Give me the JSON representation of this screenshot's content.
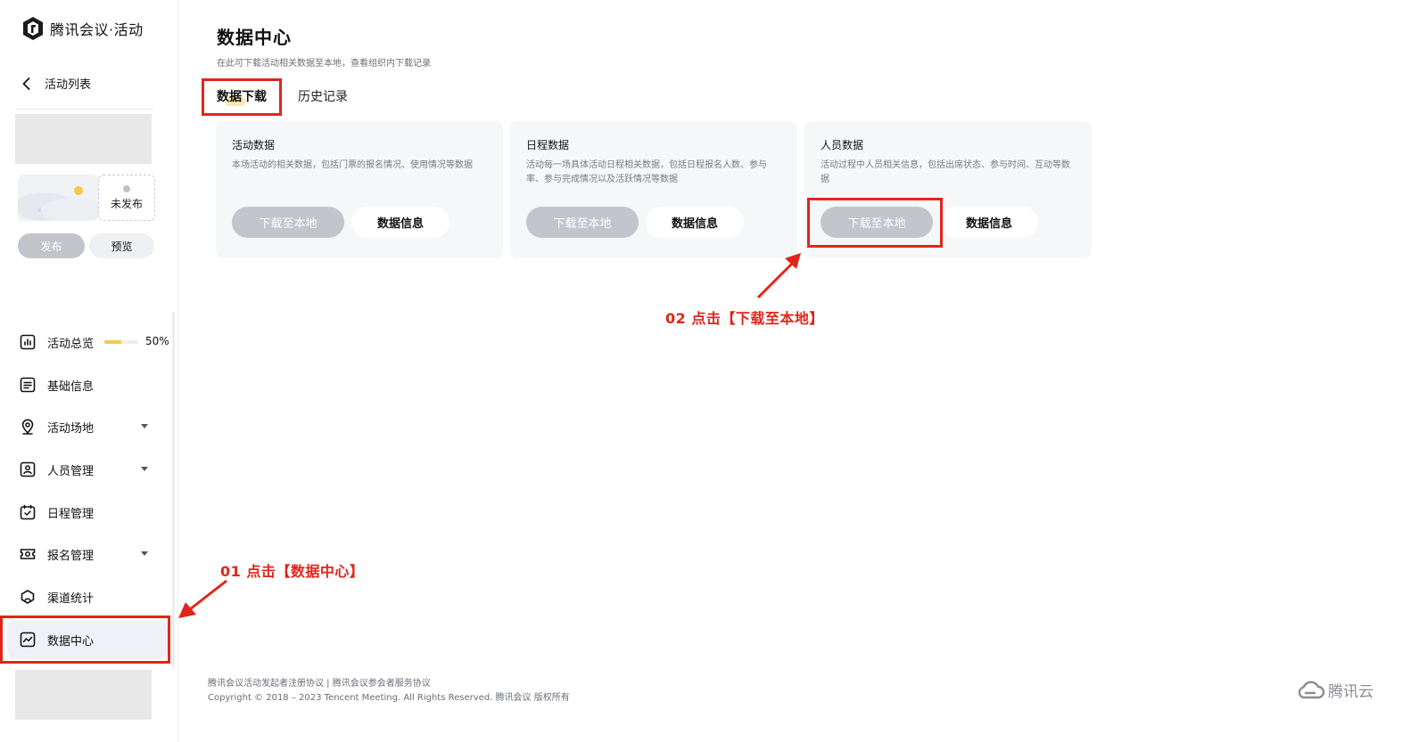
{
  "app": {
    "name": "腾讯会议·活动"
  },
  "sidebar": {
    "back_label": "活动列表",
    "status": "未发布",
    "publish_label": "发布",
    "preview_label": "预览",
    "overview": {
      "label": "活动总览",
      "progress_text": "50%",
      "progress": 0.5
    },
    "items": [
      {
        "label": "基础信息",
        "icon": "list-icon",
        "has_caret": false
      },
      {
        "label": "活动场地",
        "icon": "location-pin-icon",
        "has_caret": true
      },
      {
        "label": "人员管理",
        "icon": "contact-card-icon",
        "has_caret": true
      },
      {
        "label": "日程管理",
        "icon": "calendar-check-icon",
        "has_caret": false
      },
      {
        "label": "报名管理",
        "icon": "ticket-icon",
        "has_caret": true
      },
      {
        "label": "渠道统计",
        "icon": "channel-icon",
        "has_caret": false
      },
      {
        "label": "数据中心",
        "icon": "data-chart-icon",
        "has_caret": false,
        "active": true
      }
    ]
  },
  "main": {
    "title": "数据中心",
    "subtitle": "在此可下载活动相关数据至本地，查看组织内下载记录",
    "tabs": [
      {
        "label": "数据下载",
        "active": true
      },
      {
        "label": "历史记录",
        "active": false
      }
    ],
    "cards": [
      {
        "title": "活动数据",
        "desc": "本场活动的相关数据，包括门票的报名情况、使用情况等数据",
        "download_label": "下载至本地",
        "info_label": "数据信息"
      },
      {
        "title": "日程数据",
        "desc": "活动每一场具体活动日程相关数据，包括日程报名人数、参与率、参与完成情况以及活跃情况等数据",
        "download_label": "下载至本地",
        "info_label": "数据信息"
      },
      {
        "title": "人员数据",
        "desc": "活动过程中人员相关信息，包括出席状态、参与时间、互动等数据",
        "download_label": "下载至本地",
        "info_label": "数据信息"
      }
    ]
  },
  "annotations": {
    "step1": "01 点击【数据中心】",
    "step2": "02 点击【下载至本地】",
    "color": "#e1251b"
  },
  "footer": {
    "links": "腾讯会议活动发起者注册协议 | 腾讯会议参会者服务协议",
    "copyright": "Copyright © 2018 – 2023 Tencent Meeting. All Rights Reserved. 腾讯会议 版权所有",
    "brand": "腾讯云"
  }
}
